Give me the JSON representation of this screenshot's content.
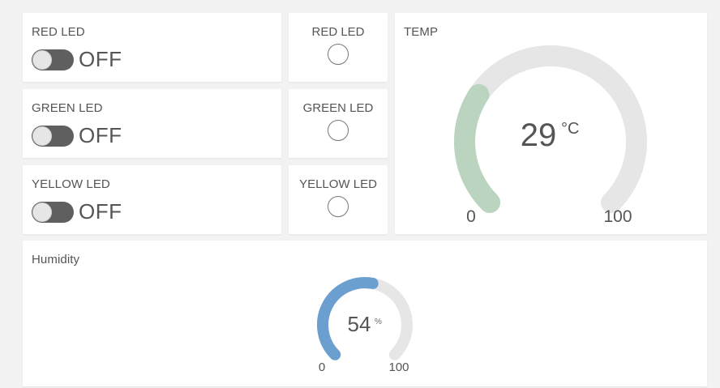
{
  "switches": [
    {
      "label": "RED LED",
      "state": "OFF"
    },
    {
      "label": "GREEN LED",
      "state": "OFF"
    },
    {
      "label": "YELLOW LED",
      "state": "OFF"
    }
  ],
  "leds": [
    {
      "label": "RED LED"
    },
    {
      "label": "GREEN LED"
    },
    {
      "label": "YELLOW LED"
    }
  ],
  "temp_gauge": {
    "title": "TEMP",
    "value": 29,
    "value_text": "29",
    "unit": "°C",
    "min": 0,
    "max": 100,
    "min_label": "0",
    "max_label": "100",
    "color": "#bad4bf",
    "track_color": "#e6e6e6"
  },
  "humidity_gauge": {
    "title": "Humidity",
    "value": 54,
    "value_text": "54",
    "unit": "%",
    "min": 0,
    "max": 100,
    "min_label": "0",
    "max_label": "100",
    "color": "#6b9fcf",
    "track_color": "#e6e6e6"
  }
}
